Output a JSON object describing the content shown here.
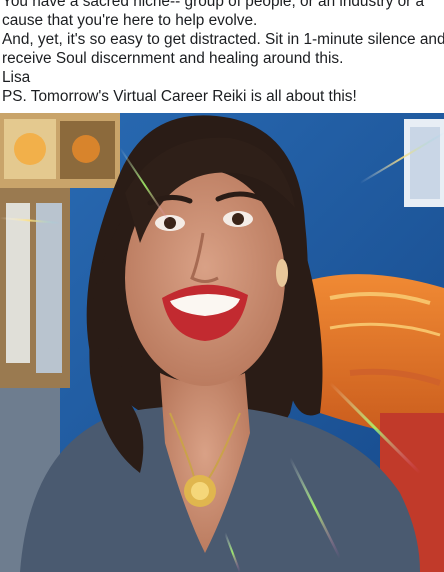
{
  "post": {
    "caption_lines": [
      "You have a sacred niche-- group of people, or an industry or a",
      "cause that you're here to help evolve.",
      "And, yet, it's so easy to get distracted. Sit in 1-minute silence and",
      "receive Soul discernment and healing around this.",
      "Lisa",
      "PS. Tomorrow's Virtual Career Reiki is all about this!"
    ]
  },
  "video": {
    "colors": {
      "wall_blue": "#1f5fa8",
      "cushion_orange": "#e8782a",
      "shirt_slate": "#4a5a70",
      "hair_dark": "#2a1c16",
      "skin": "#c98e72",
      "lips": "#c22a30"
    }
  }
}
